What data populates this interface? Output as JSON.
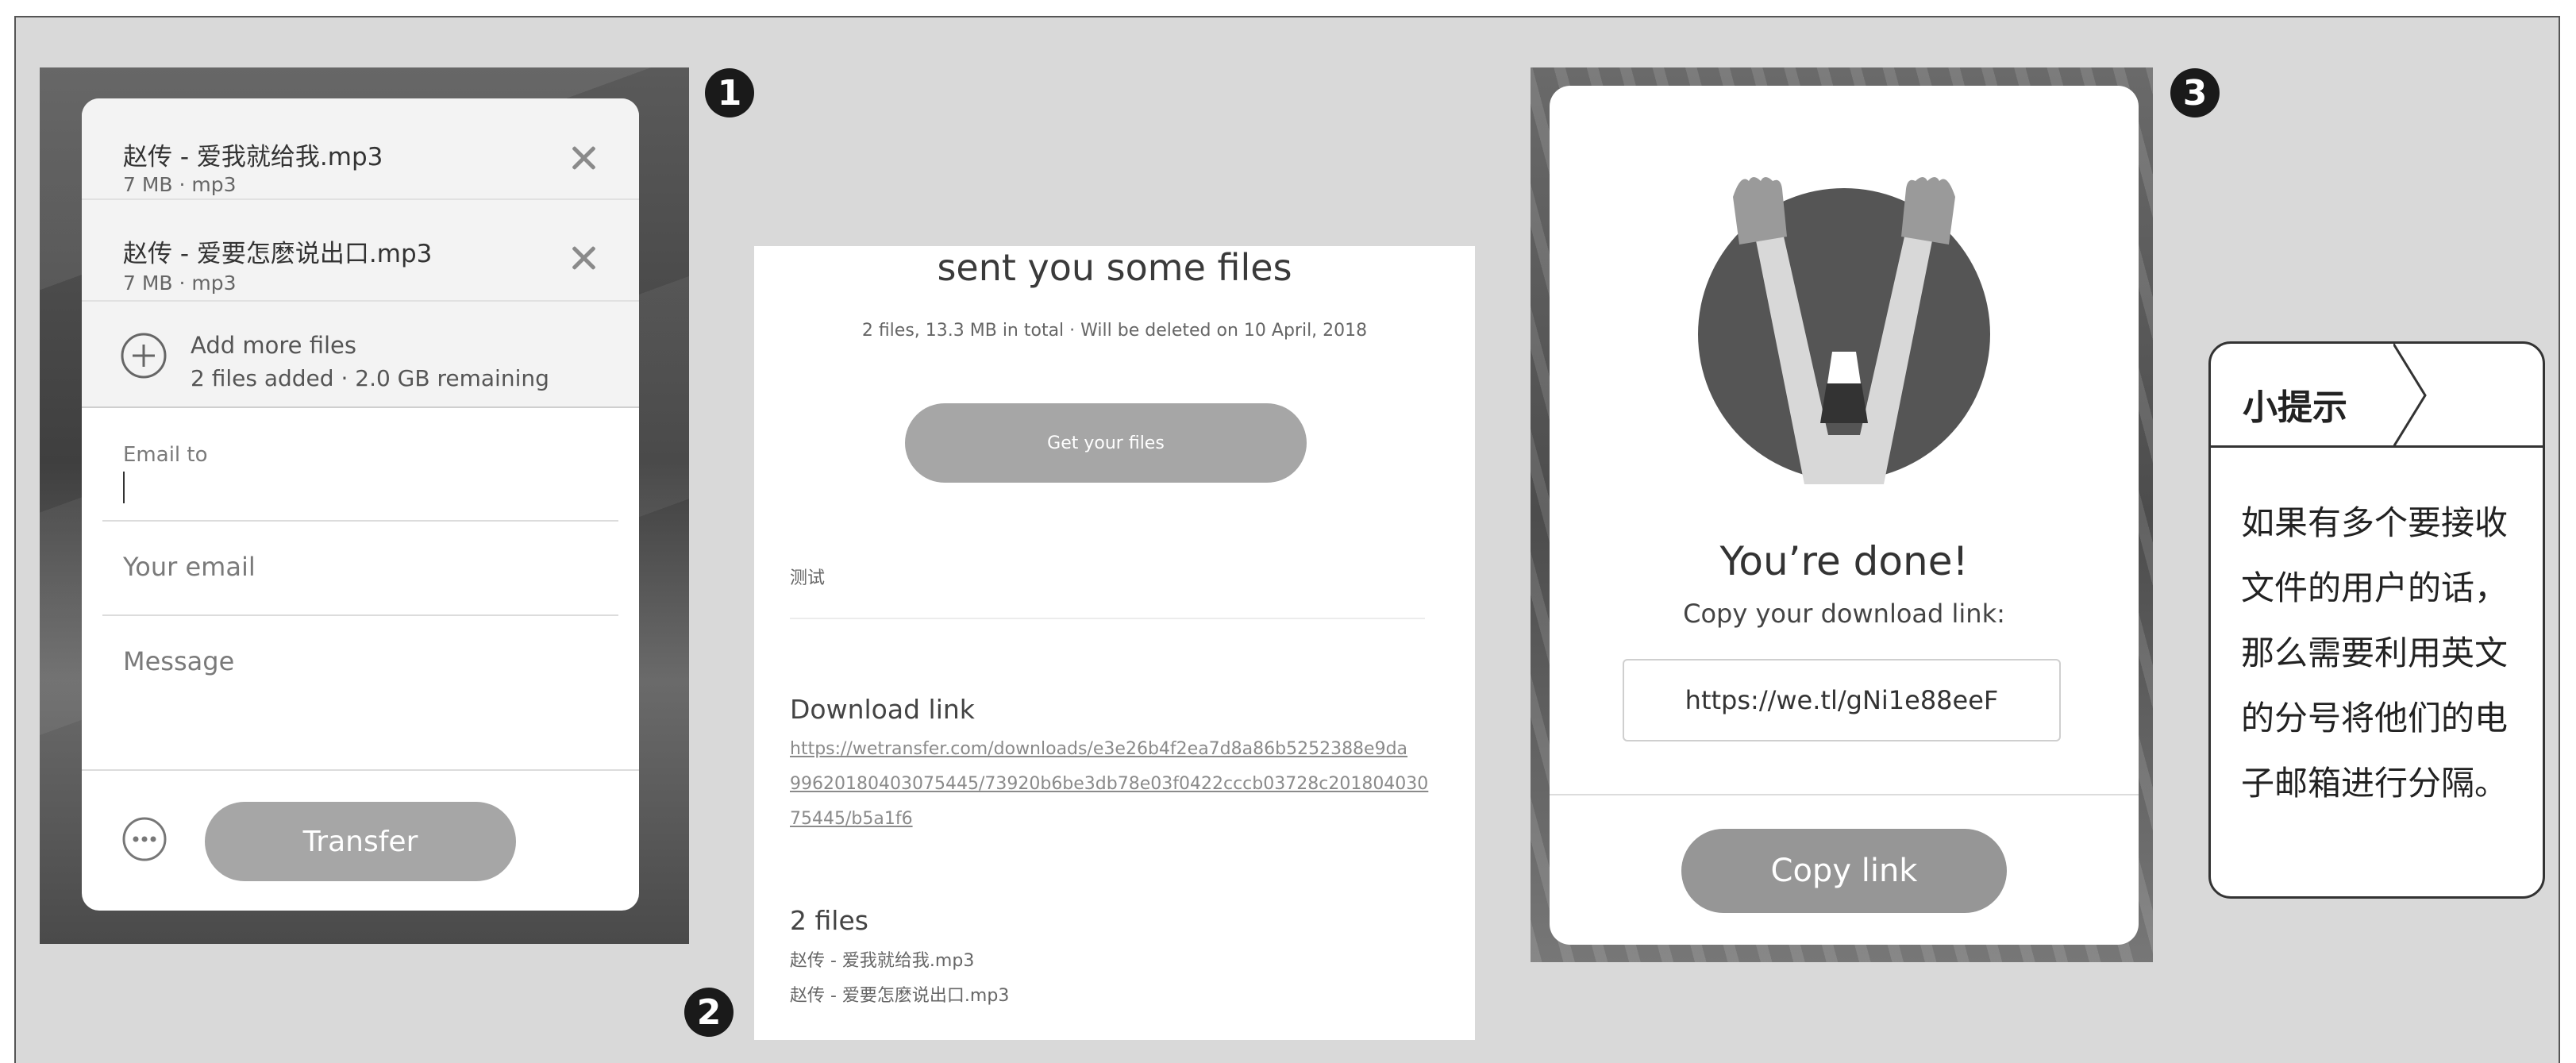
{
  "steps": [
    "1",
    "2",
    "3"
  ],
  "panel1": {
    "files": [
      {
        "name": "赵传 - 爱我就给我.mp3",
        "meta": "7 MB · mp3"
      },
      {
        "name": "赵传 - 爱要怎麽说出口.mp3",
        "meta": "7 MB · mp3"
      }
    ],
    "add_more": {
      "label": "Add more files",
      "sub": "2 files added · 2.0 GB remaining"
    },
    "email_to_label": "Email to",
    "your_email_placeholder": "Your email",
    "message_placeholder": "Message",
    "transfer_label": "Transfer"
  },
  "panel2": {
    "heading": "sent you some files",
    "summary": "2 files, 13.3 MB in total · Will be deleted on 10 April, 2018",
    "get_files_label": "Get your files",
    "message_text": "测试",
    "download_link_label": "Download link",
    "download_link_lines": [
      "https://wetransfer.com/downloads/e3e26b4f2ea7d8a86b5252388e9da",
      "99620180403075445/73920b6be3db78e03f0422cccb03728c201804030",
      "75445/b5a1f6"
    ],
    "files_heading": "2 files",
    "file_list": [
      "赵传 - 爱我就给我.mp3",
      "赵传 - 爱要怎麽说出口.mp3"
    ]
  },
  "panel3": {
    "done_title": "You’re done!",
    "copy_prompt": "Copy your download link:",
    "link_value": "https://we.tl/gNi1e88eeF",
    "copy_button_label": "Copy link"
  },
  "tip": {
    "title": "小提示",
    "body": "如果有多个要接收文件的用户的话，那么需要利用英文的分号将他们的电子邮箱进行分隔。"
  },
  "colors": {
    "button_gray": "#a6a6a6",
    "frame_bg": "#d9d9d9"
  }
}
